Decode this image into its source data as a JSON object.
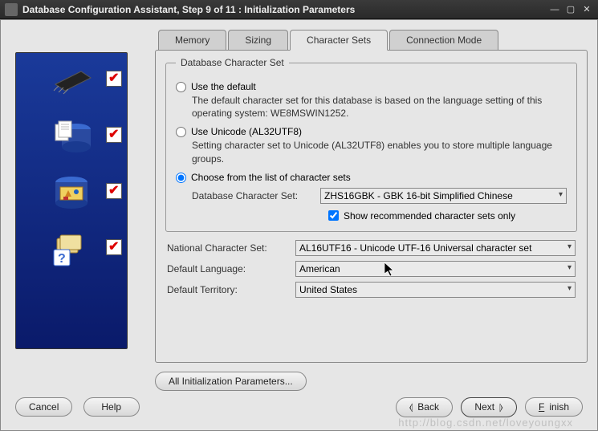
{
  "window": {
    "title": "Database Configuration Assistant, Step 9 of 11 : Initialization Parameters"
  },
  "tabs": [
    {
      "label": "Memory"
    },
    {
      "label": "Sizing"
    },
    {
      "label": "Character Sets"
    },
    {
      "label": "Connection Mode"
    }
  ],
  "group": {
    "legend": "Database Character Set",
    "radio_default": {
      "label": "Use the default",
      "desc": "The default character set for this database is based on the language setting of this operating system: WE8MSWIN1252."
    },
    "radio_unicode": {
      "label": "Use Unicode (AL32UTF8)",
      "desc": "Setting character set to Unicode (AL32UTF8) enables you to store multiple language groups."
    },
    "radio_list": {
      "label": "Choose from the list of character sets",
      "db_cs_label": "Database Character Set:",
      "db_cs_value": "ZHS16GBK - GBK 16-bit Simplified Chinese",
      "recommended_label": "Show recommended character sets only"
    }
  },
  "national": {
    "label": "National Character Set:",
    "value": "AL16UTF16 - Unicode UTF-16 Universal character set"
  },
  "language": {
    "label": "Default Language:",
    "value": "American"
  },
  "territory": {
    "label": "Default Territory:",
    "value": "United States"
  },
  "all_params_label": "All Initialization Parameters...",
  "buttons": {
    "cancel": "Cancel",
    "help": "Help",
    "back": "Back",
    "next": "Next",
    "finish": "Finish"
  },
  "watermark": "http://blog.csdn.net/loveyoungxx"
}
